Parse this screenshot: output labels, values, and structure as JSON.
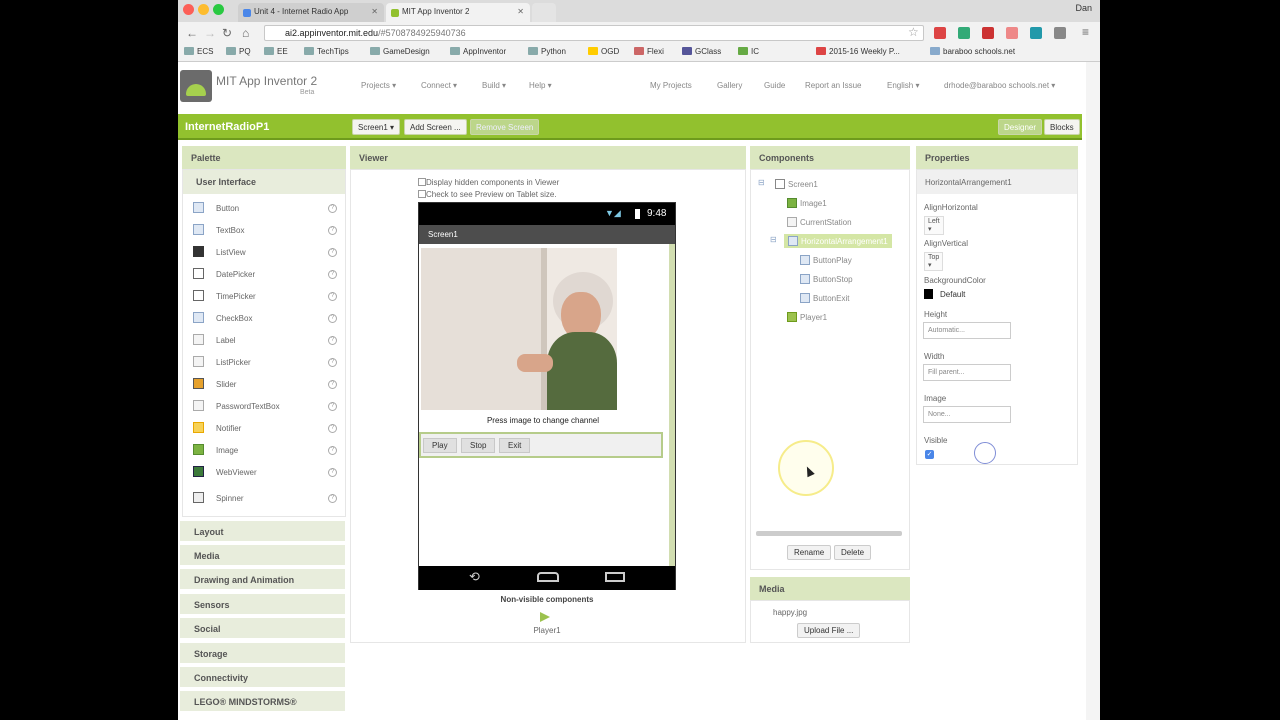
{
  "browser": {
    "tabs": [
      {
        "label": "Unit 4 - Internet Radio App"
      },
      {
        "label": "MIT App Inventor 2"
      }
    ],
    "user": "Dan",
    "url_host": "ai2.appinventor.mit.edu",
    "url_path": "/#5708784925940736",
    "bookmarks": [
      "ECS",
      "PQ",
      "EE",
      "TechTips",
      "GameDesign",
      "AppInventor",
      "Python",
      "OGD",
      "Flexi",
      "GClass",
      "IC",
      "2015-16 Weekly P...",
      "baraboo schools.net"
    ]
  },
  "app": {
    "title": "MIT App Inventor 2",
    "subtitle": "Beta",
    "menus": [
      "Projects ▾",
      "Connect ▾",
      "Build ▾",
      "Help ▾"
    ],
    "right_menus": [
      "My Projects",
      "Gallery",
      "Guide",
      "Report an Issue",
      "English ▾",
      "drhode@baraboo schools.net ▾"
    ]
  },
  "toolbar": {
    "project_name": "InternetRadioP1",
    "screen_select": "Screen1 ▾",
    "add_screen": "Add Screen ...",
    "remove_screen": "Remove Screen",
    "designer": "Designer",
    "blocks": "Blocks"
  },
  "palette": {
    "title": "Palette",
    "section": "User Interface",
    "items": [
      "Button",
      "TextBox",
      "ListView",
      "DatePicker",
      "TimePicker",
      "CheckBox",
      "Label",
      "ListPicker",
      "Slider",
      "PasswordTextBox",
      "Notifier",
      "Image",
      "WebViewer",
      "Spinner"
    ],
    "categories": [
      "Layout",
      "Media",
      "Drawing and Animation",
      "Sensors",
      "Social",
      "Storage",
      "Connectivity",
      "LEGO® MINDSTORMS®"
    ]
  },
  "viewer": {
    "title": "Viewer",
    "checkbox1": "Display hidden components in Viewer",
    "checkbox2": "Check to see Preview on Tablet size.",
    "time": "9:48",
    "screen_title": "Screen1",
    "caption": "Press image to change channel",
    "buttons": [
      "Play",
      "Stop",
      "Exit"
    ],
    "nonvisible_title": "Non-visible components",
    "nonvisible_item": "Player1"
  },
  "components": {
    "title": "Components",
    "tree": [
      "Screen1",
      "Image1",
      "CurrentStation",
      "HorizontalArrangement1",
      "ButtonPlay",
      "ButtonStop",
      "ButtonExit",
      "Player1"
    ],
    "rename": "Rename",
    "delete": "Delete"
  },
  "media": {
    "title": "Media",
    "file": "happy.jpg",
    "upload": "Upload File ..."
  },
  "properties": {
    "title": "Properties",
    "component": "HorizontalArrangement1",
    "align_h_label": "AlignHorizontal",
    "align_h_value": "Left ▾",
    "align_v_label": "AlignVertical",
    "align_v_value": "Top ▾",
    "bg_label": "BackgroundColor",
    "bg_value": "Default",
    "height_label": "Height",
    "height_value": "Automatic...",
    "width_label": "Width",
    "width_value": "Fill parent...",
    "image_label": "Image",
    "image_value": "None...",
    "visible_label": "Visible",
    "visible_checked": true
  },
  "colors": {
    "accent_green": "#92c12e",
    "panel_header": "#dbe7c0"
  }
}
